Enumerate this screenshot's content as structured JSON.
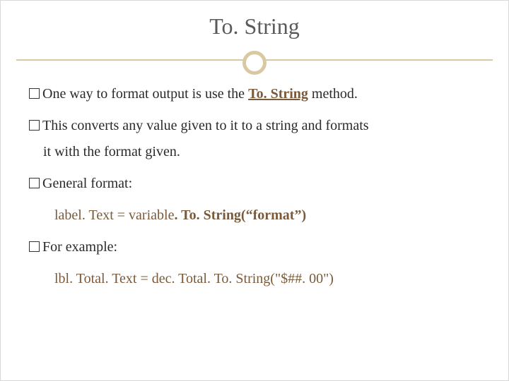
{
  "title": "To. String",
  "bullets": {
    "b1_pre": "One way to format output is use the ",
    "b1_mid": "To. String",
    "b1_post": " method.",
    "b2_line1": "This converts any value given to it to a string and formats",
    "b2_line2": "it with the format given.",
    "b3": "General format:",
    "b4": "For example:"
  },
  "code": {
    "line1_a": "label. Text = variable",
    "line1_b": ". To. String(“format”)",
    "line2": "lbl. Total. Text = dec. Total. To. String(\"$##. 00\")"
  }
}
